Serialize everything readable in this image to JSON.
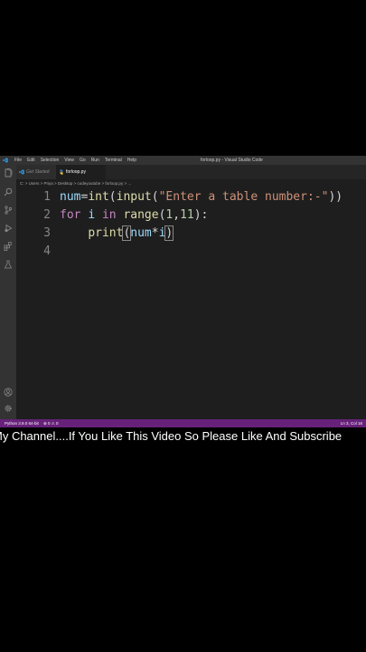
{
  "titlebar": {
    "menu": [
      "File",
      "Edit",
      "Selection",
      "View",
      "Go",
      "Run",
      "Terminal",
      "Help"
    ],
    "window_title": "forloop.py - Visual Studio Code"
  },
  "tabs": [
    {
      "label": "Get Started"
    },
    {
      "label": "forloop.py"
    }
  ],
  "breadcrumb": "C: > Users > Priya > Desktop > codeyoutube > forloop.py > ...",
  "editor": {
    "line_numbers": [
      "1",
      "2",
      "3",
      "4"
    ],
    "lines": [
      "num=int(input(\"Enter a table number:-\"))",
      "for i in range(1,11):",
      "    print(num*i)",
      ""
    ]
  },
  "statusbar": {
    "python": "Python 3.9.0 64-bit",
    "problems": "⊗ 0 ⚠ 0",
    "cursor": "Ln 3, Col 16"
  },
  "subtitle": "My Channel....If You Like This Video So Please Like And Subscribe",
  "colors": {
    "statusbar": "#68217a",
    "editor_bg": "#1e1e1e",
    "keyword": "#c586c0",
    "function": "#dcdcaa",
    "string": "#ce9178",
    "number": "#b5cea8",
    "variable": "#9cdcfe"
  },
  "icons": [
    "vscode-logo-icon",
    "explorer-icon",
    "search-icon",
    "source-control-icon",
    "run-debug-icon",
    "extensions-icon",
    "testing-icon",
    "account-icon",
    "settings-gear-icon",
    "python-file-icon"
  ]
}
